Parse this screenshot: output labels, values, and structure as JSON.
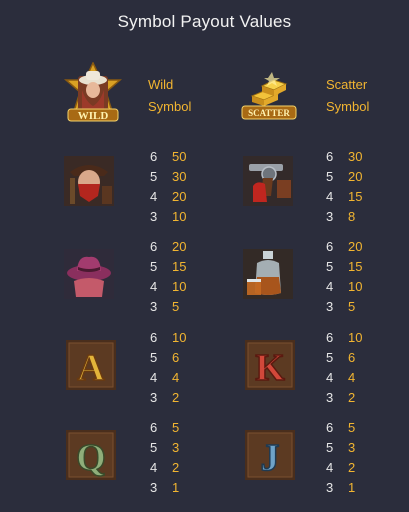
{
  "title": "Symbol Payout Values",
  "special_symbols": [
    {
      "icon": "wild-sheriff-badge-icon",
      "icon_text": "WILD",
      "label_line1": "Wild",
      "label_line2": "Symbol"
    },
    {
      "icon": "scatter-gold-bars-icon",
      "icon_text": "SCATTER",
      "label_line1": "Scatter",
      "label_line2": "Symbol"
    }
  ],
  "symbols": [
    {
      "icon": "outlaw-bandit-icon",
      "rows": [
        {
          "count": "6",
          "pay": "50"
        },
        {
          "count": "5",
          "pay": "30"
        },
        {
          "count": "4",
          "pay": "20"
        },
        {
          "count": "3",
          "pay": "10"
        }
      ]
    },
    {
      "icon": "revolver-icon",
      "rows": [
        {
          "count": "6",
          "pay": "30"
        },
        {
          "count": "5",
          "pay": "20"
        },
        {
          "count": "4",
          "pay": "15"
        },
        {
          "count": "3",
          "pay": "8"
        }
      ]
    },
    {
      "icon": "cowboy-hat-icon",
      "rows": [
        {
          "count": "6",
          "pay": "20"
        },
        {
          "count": "5",
          "pay": "15"
        },
        {
          "count": "4",
          "pay": "10"
        },
        {
          "count": "3",
          "pay": "5"
        }
      ]
    },
    {
      "icon": "whiskey-bottle-icon",
      "rows": [
        {
          "count": "6",
          "pay": "20"
        },
        {
          "count": "5",
          "pay": "15"
        },
        {
          "count": "4",
          "pay": "10"
        },
        {
          "count": "3",
          "pay": "5"
        }
      ]
    },
    {
      "icon": "letter-a-icon",
      "glyph": "A",
      "rows": [
        {
          "count": "6",
          "pay": "10"
        },
        {
          "count": "5",
          "pay": "6"
        },
        {
          "count": "4",
          "pay": "4"
        },
        {
          "count": "3",
          "pay": "2"
        }
      ]
    },
    {
      "icon": "letter-k-icon",
      "glyph": "K",
      "rows": [
        {
          "count": "6",
          "pay": "10"
        },
        {
          "count": "5",
          "pay": "6"
        },
        {
          "count": "4",
          "pay": "4"
        },
        {
          "count": "3",
          "pay": "2"
        }
      ]
    },
    {
      "icon": "letter-q-icon",
      "glyph": "Q",
      "rows": [
        {
          "count": "6",
          "pay": "5"
        },
        {
          "count": "5",
          "pay": "3"
        },
        {
          "count": "4",
          "pay": "2"
        },
        {
          "count": "3",
          "pay": "1"
        }
      ]
    },
    {
      "icon": "letter-j-icon",
      "glyph": "J",
      "rows": [
        {
          "count": "6",
          "pay": "5"
        },
        {
          "count": "5",
          "pay": "3"
        },
        {
          "count": "4",
          "pay": "2"
        },
        {
          "count": "3",
          "pay": "1"
        }
      ]
    }
  ],
  "colors": {
    "background": "#2b2d3c",
    "accent": "#f2b531",
    "text": "#e6e6e6"
  }
}
